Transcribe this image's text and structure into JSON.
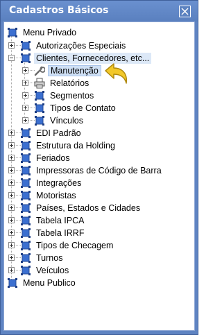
{
  "window": {
    "title": "Cadastros Básicos",
    "close_icon": "close-icon"
  },
  "colors": {
    "titlebar": "#5f84c2",
    "node_square": "#3b6fd0",
    "highlight": "#dce8f7",
    "arrow": "#f2c82a"
  },
  "tree": {
    "root_private": "Menu Privado",
    "items": [
      {
        "label": "Autorizações Especiais",
        "toggle": "+"
      },
      {
        "label": "Clientes, Fornecedores, etc...",
        "toggle": "-"
      },
      {
        "label": "EDI Padrão",
        "toggle": "+"
      },
      {
        "label": "Estrutura da Holding",
        "toggle": "+"
      },
      {
        "label": "Feriados",
        "toggle": "+"
      },
      {
        "label": "Impressoras de Código de Barra",
        "toggle": "+"
      },
      {
        "label": "Integrações",
        "toggle": "+"
      },
      {
        "label": "Motoristas",
        "toggle": "+"
      },
      {
        "label": "Países, Estados e Cidades",
        "toggle": "+"
      },
      {
        "label": "Tabela IPCA",
        "toggle": "+"
      },
      {
        "label": "Tabela IRRF",
        "toggle": "+"
      },
      {
        "label": "Tipos de Checagem",
        "toggle": "+"
      },
      {
        "label": "Turnos",
        "toggle": "+"
      },
      {
        "label": "Veículos",
        "toggle": "+"
      }
    ],
    "clientes_children": [
      {
        "label": "Manutenção",
        "icon": "wrench-icon"
      },
      {
        "label": "Relatórios",
        "icon": "printer-icon"
      },
      {
        "label": "Segmentos",
        "icon": "square-node-icon"
      },
      {
        "label": "Tipos de Contato",
        "icon": "square-node-icon"
      },
      {
        "label": "Vínculos",
        "icon": "square-node-icon"
      }
    ],
    "root_public": "Menu Publico"
  }
}
